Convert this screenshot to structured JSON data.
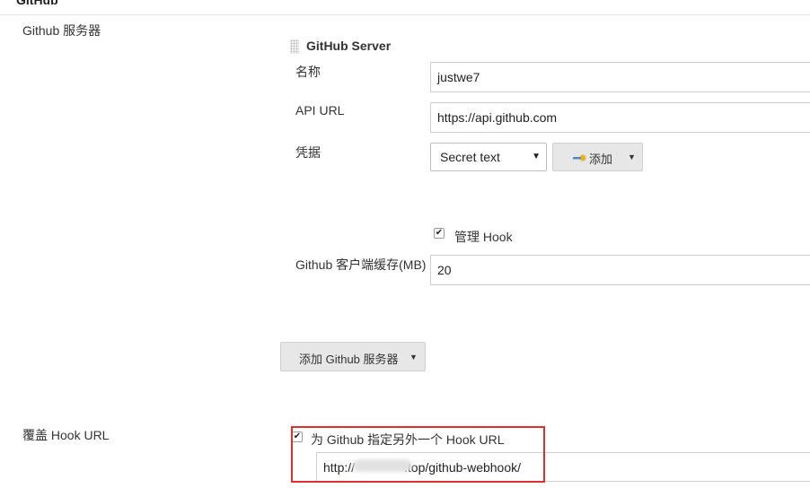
{
  "section": {
    "title": "GitHub"
  },
  "github_servers": {
    "label": "Github 服务器",
    "server": {
      "title": "GitHub Server",
      "name_label": "名称",
      "name_value": "justwe7",
      "api_url_label": "API URL",
      "api_url_value": "https://api.github.com",
      "credentials_label": "凭据",
      "credentials_selected": "Secret text",
      "credentials_add_button": "添加",
      "manage_hook_label": "管理 Hook",
      "manage_hook_checked": true,
      "cache_label": "Github 客户端缓存(MB)",
      "cache_value": "20"
    },
    "add_server_button": "添加 Github 服务器"
  },
  "override_hook": {
    "label": "覆盖 Hook URL",
    "checkbox_label": "为 Github 指定另外一个 Hook URL",
    "checked": true,
    "url_prefix": "http://",
    "url_suffix": ".top/github-webhook/"
  },
  "colors": {
    "highlight": "#e0302e",
    "button_bg": "#e7e7e7"
  }
}
